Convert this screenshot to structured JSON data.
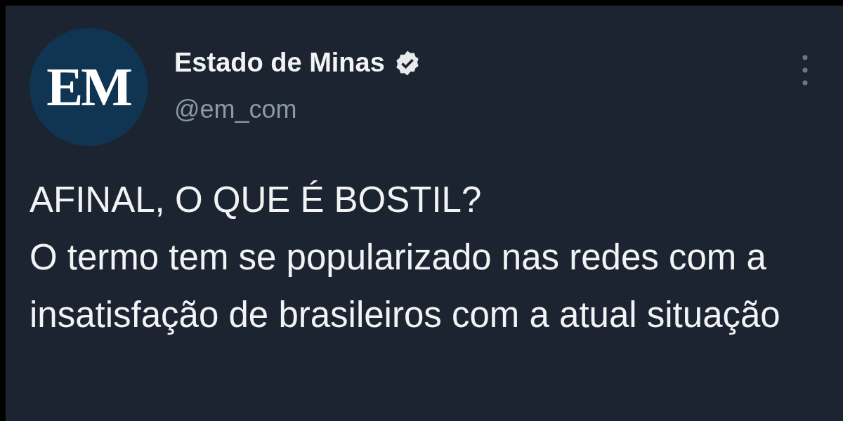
{
  "tweet": {
    "avatar_text": "EM",
    "author": "Estado de Minas",
    "verified": true,
    "handle": "@em_com",
    "headline": "AFINAL, O QUE É BOSTIL?",
    "body": "O termo tem se popularizado nas redes com a insatisfação de brasileiros com a atual situação"
  }
}
